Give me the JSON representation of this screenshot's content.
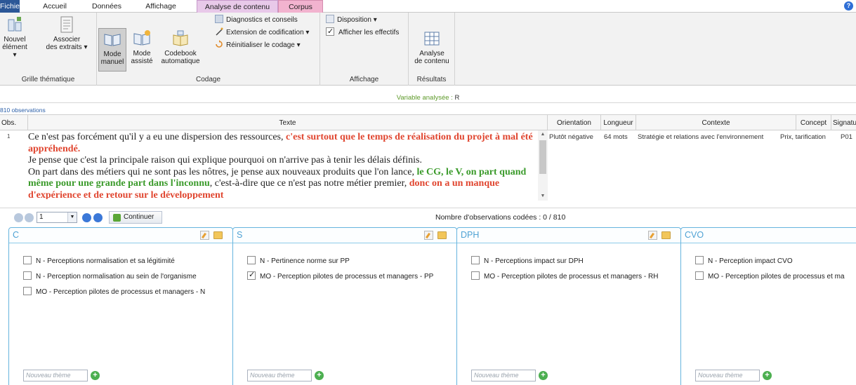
{
  "tabs": {
    "fichier": "Fichier",
    "accueil": "Accueil",
    "donnees": "Données",
    "affichage": "Affichage",
    "analyse": "Analyse de contenu",
    "corpus": "Corpus"
  },
  "ribbon": {
    "grille": {
      "label": "Grille thématique",
      "nouvel_1": "Nouvel",
      "nouvel_2": "élément ▾",
      "associer_1": "Associer",
      "associer_2": "des extraits ▾"
    },
    "codage": {
      "label": "Codage",
      "mode_manuel_1": "Mode",
      "mode_manuel_2": "manuel",
      "mode_assiste_1": "Mode",
      "mode_assiste_2": "assisté",
      "codebook_1": "Codebook",
      "codebook_2": "automatique",
      "diagnostics": "Diagnostics et conseils",
      "extension": "Extension de codification ▾",
      "reinitialiser": "Réinitialiser le codage ▾"
    },
    "affichage": {
      "label": "Affichage",
      "disposition": "Disposition ▾",
      "afficher": "Afficher les effectifs"
    },
    "resultats": {
      "label": "Résultats",
      "analyse_1": "Analyse",
      "analyse_2": "de contenu"
    }
  },
  "variable_bar": {
    "label": "Variable analysée : ",
    "value": "R"
  },
  "observations_count": "810 observations",
  "grid": {
    "headers": {
      "obs": "Obs.",
      "texte": "Texte",
      "orientation": "Orientation",
      "longueur": "Longueur",
      "contexte": "Contexte",
      "concept": "Concept",
      "signature": "Signatu"
    },
    "row": {
      "num": "1",
      "orientation": "Plutôt négative",
      "longueur": "64 mots",
      "contexte": "Stratégie et relations avec l'environnement",
      "concept": "Prix, tarification",
      "signature": "P01",
      "text": {
        "s1": "Ce n'est pas forcément qu'il y a eu une dispersion des ressources, ",
        "s2": "c'est surtout que le temps de réalisation du projet à mal été appréhendé.",
        "s3": "Je pense que c'est la principale raison qui explique pourquoi on n'arrive pas à tenir les délais définis.",
        "s4": "On part dans des métiers qui ne sont pas les nôtres, je pense aux nouveaux produits que l'on lance, ",
        "s5": "le CG, le V, on part quand même pour une grande part dans l'inconnu",
        "s6": ", c'est-à-dire que ce n'est pas notre métier premier, ",
        "s7": "donc on a un manque d'expérience et de retour sur le développement"
      }
    }
  },
  "navbar": {
    "current_obs": "1",
    "continue_label": "Continuer",
    "coded_label": "Nombre d'observations codées : 0 / 810"
  },
  "panels": [
    {
      "title": "C",
      "items": [
        {
          "label": "N - Perceptions normalisation et sa légitimité",
          "checked": false
        },
        {
          "label": "N - Perception normalisation au sein de l'organisme",
          "checked": false
        },
        {
          "label": "MO - Perception pilotes de processus et managers - N",
          "checked": false
        }
      ],
      "placeholder": "Nouveau thème"
    },
    {
      "title": "S",
      "items": [
        {
          "label": "N - Pertinence norme sur PP",
          "checked": false
        },
        {
          "label": "MO - Perception pilotes de processus et managers - PP",
          "checked": true
        }
      ],
      "placeholder": "Nouveau thème"
    },
    {
      "title": "DPH",
      "items": [
        {
          "label": "N - Perceptions impact sur DPH",
          "checked": false
        },
        {
          "label": "MO - Perception pilotes de processus et managers - RH",
          "checked": false
        }
      ],
      "placeholder": "Nouveau thème"
    },
    {
      "title": "CVO",
      "items": [
        {
          "label": "N - Perception impact CVO",
          "checked": false
        },
        {
          "label": "MO - Perception pilotes de processus et ma",
          "checked": false
        }
      ],
      "placeholder": "Nouveau thème"
    }
  ]
}
